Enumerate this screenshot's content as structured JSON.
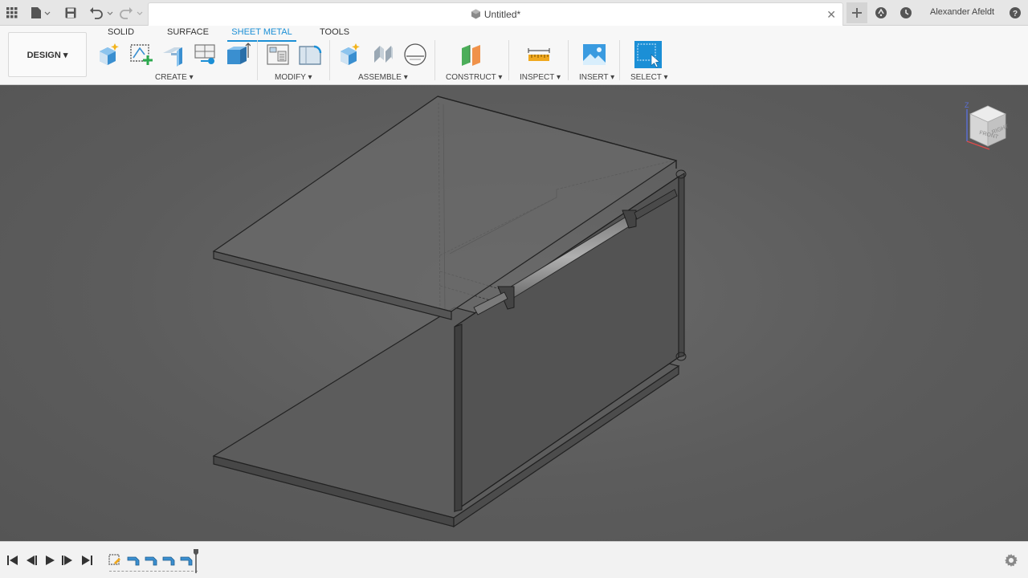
{
  "titlebar": {
    "document_title": "Untitled*",
    "user_name": "Alexander Afeldt"
  },
  "ribbon": {
    "workspace_label": "DESIGN ▾",
    "tabs": [
      {
        "label": "SOLID"
      },
      {
        "label": "SURFACE"
      },
      {
        "label": "SHEET METAL"
      },
      {
        "label": "TOOLS"
      }
    ],
    "active_tab": "SHEET METAL",
    "groups": {
      "create": "CREATE ▾",
      "modify": "MODIFY ▾",
      "assemble": "ASSEMBLE ▾",
      "construct": "CONSTRUCT ▾",
      "inspect": "INSPECT ▾",
      "insert": "INSERT ▾",
      "select": "SELECT ▾"
    }
  },
  "viewcube": {
    "front_face": "FRONT",
    "right_face": "RIGHT",
    "axis_label": "Z"
  },
  "icons": {
    "accent": "#1b8fd6",
    "tools": [
      "new-component-icon",
      "create-sketch-icon",
      "flange-icon",
      "unfold-icon",
      "extrude-icon",
      "press-pull-icon",
      "fillet-icon",
      "joint-icon",
      "as-built-joint-icon",
      "motion-link-icon",
      "offset-plane-icon",
      "measure-icon",
      "insert-image-icon",
      "select-icon"
    ]
  },
  "timeline": {
    "features_count_visible": 5
  }
}
